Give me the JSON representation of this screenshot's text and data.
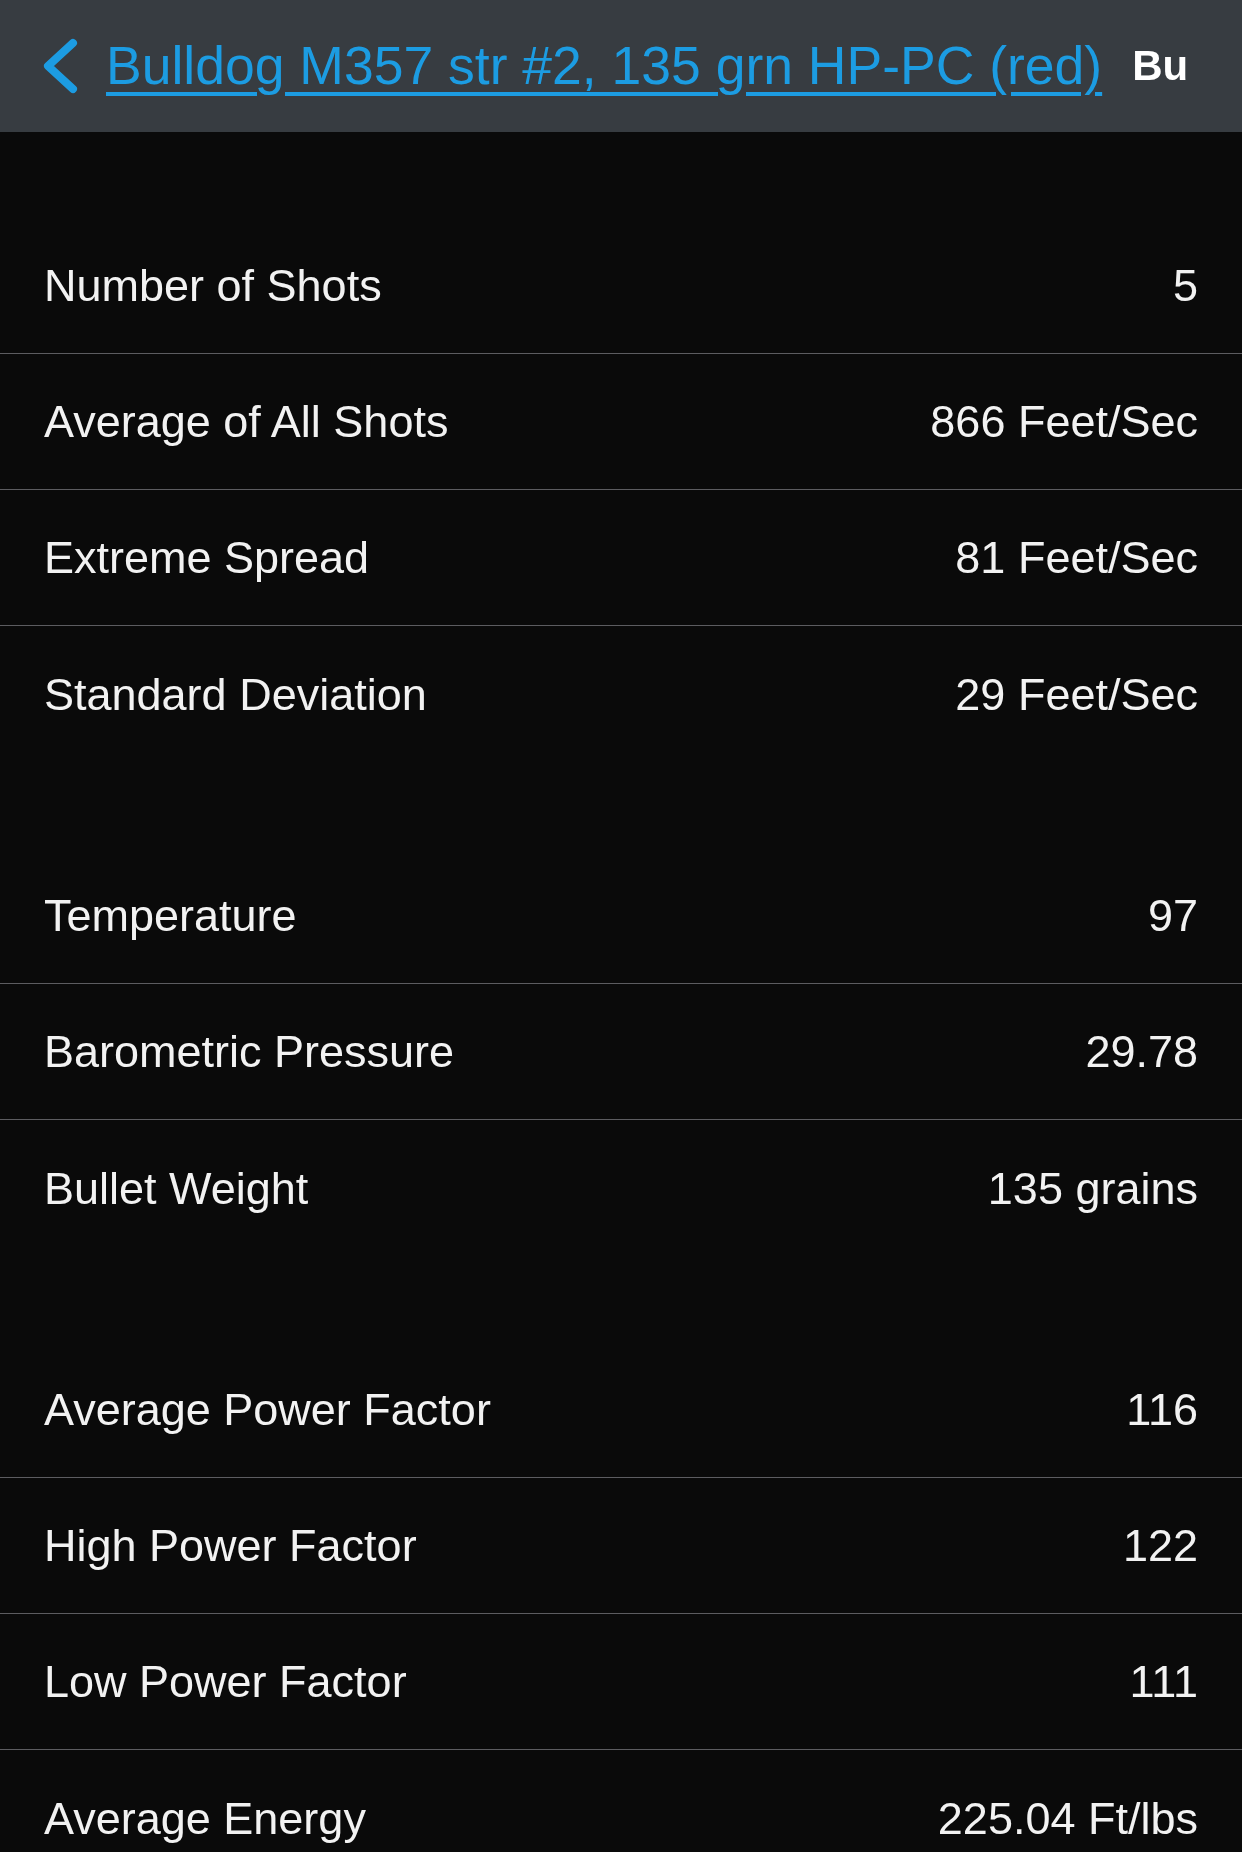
{
  "nav_bar": {
    "back_link": {
      "label": "Bulldog M357 str #2, 135 grn HP-PC (red)"
    },
    "title": "Bu"
  },
  "sections": [
    {
      "rows": [
        {
          "label": "Number of Shots",
          "value": "5"
        },
        {
          "label": "Average of All Shots",
          "value": "866 Feet/Sec"
        },
        {
          "label": "Extreme Spread",
          "value": "81 Feet/Sec"
        },
        {
          "label": "Standard Deviation",
          "value": "29 Feet/Sec"
        }
      ]
    },
    {
      "rows": [
        {
          "label": "Temperature",
          "value": "97"
        },
        {
          "label": "Barometric Pressure",
          "value": "29.78"
        },
        {
          "label": "Bullet Weight",
          "value": "135 grains"
        }
      ]
    },
    {
      "rows": [
        {
          "label": "Average Power Factor",
          "value": "116"
        },
        {
          "label": "High Power Factor",
          "value": "122"
        },
        {
          "label": "Low Power Factor",
          "value": "111"
        },
        {
          "label": "Average Energy",
          "value": "225.04 Ft/lbs"
        }
      ]
    }
  ]
}
